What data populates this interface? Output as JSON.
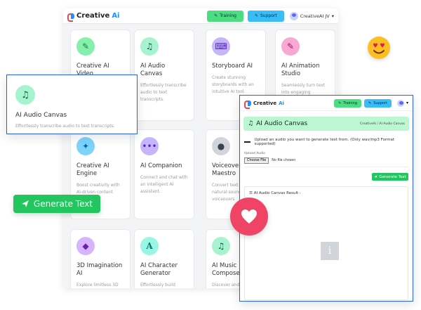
{
  "app": {
    "logo_main": "Creative",
    "logo_ai": "Ai"
  },
  "bg_header": {
    "training": "Training",
    "support": "Support",
    "user": "CreativeAI JV"
  },
  "bg_cards": [
    {
      "title": "Creative AI Video",
      "desc": "",
      "icon": "pen-icon",
      "icon_bg": "#86efac",
      "icon_fg": "#15803d"
    },
    {
      "title": "AI Audio Canvas",
      "desc": "Effortlessly transcribe audio to text transcripts.",
      "icon": "music-note-icon",
      "icon_bg": "#a7f3d0",
      "icon_fg": "#065f46"
    },
    {
      "title": "Storyboard AI",
      "desc": "Create stunning storyboards with an intuitive AI tool.",
      "icon": "keyboard-icon",
      "icon_bg": "#c4b5fd",
      "icon_fg": "#5b21b6"
    },
    {
      "title": "AI Animation Studio",
      "desc": "Seamlessly turn text into engaging",
      "icon": "pen-icon",
      "icon_bg": "#f9a8d4",
      "icon_fg": "#9d174d"
    },
    {
      "title": "Creative AI Engine",
      "desc": "Boost creativity with AI-driven content",
      "icon": "lightbulb-icon",
      "icon_bg": "#7dd3fc",
      "icon_fg": "#0369a1"
    },
    {
      "title": "AI Companion",
      "desc": "Connect and chat with an intelligent AI assistant.",
      "icon": "chat-icon",
      "icon_bg": "#c4b5fd",
      "icon_fg": "#5b21b6"
    },
    {
      "title": "Voiceover Maestro",
      "desc": "Convert text to natural-sounding voiceovers",
      "icon": "microphone-icon",
      "icon_bg": "#d1d5db",
      "icon_fg": "#374151"
    },
    {
      "title": "3D Imagination AI",
      "desc": "Explore limitless 3D",
      "icon": "cube-icon",
      "icon_bg": "#d8b4fe",
      "icon_fg": "#6b21a8"
    },
    {
      "title": "AI Character Generator",
      "desc": "Effortlessly build",
      "icon": "letter-a-icon",
      "icon_bg": "#99f6e4",
      "icon_fg": "#0f766e"
    },
    {
      "title": "AI Music Composer",
      "desc": "Discover and",
      "icon": "music-note-icon",
      "icon_bg": "#a7f3d0",
      "icon_fg": "#065f46"
    }
  ],
  "float_card": {
    "title": "AI Audio Canvas",
    "desc": "Effortlessly transcribe audio to text transcripts."
  },
  "gen_pill": {
    "label": "Generate Text"
  },
  "fg": {
    "training": "Training",
    "support": "Support",
    "header_title": "AI Audio Canvas",
    "breadcrumb": "CreativeAi / AI Audio Canvas",
    "instruction": "Upload an audio you want to generate text from. (Only wav/mp3 Format supported)",
    "upload_label": "Upload Audio",
    "file_button": "Choose File",
    "file_status": "No file chosen",
    "generate_button": "Generate Text",
    "result_title": "AI Audio Canvas Result :",
    "placeholder_glyph": "i"
  }
}
